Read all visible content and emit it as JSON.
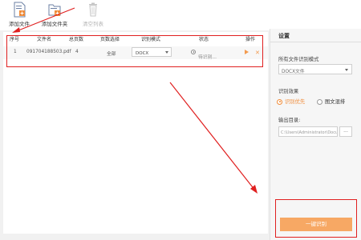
{
  "toolbar": {
    "add_file_label": "添加文件",
    "add_folder_label": "添加文件夹",
    "clear_list_label": "清空列表"
  },
  "file_table": {
    "columns": [
      "序号",
      "文件名",
      "总页数",
      "页数选择",
      "识别模式",
      "状态",
      "操作"
    ],
    "rows": [
      {
        "index": "1",
        "filename": "091704188503.pdf",
        "total_pages": "4",
        "page_selection": "全部",
        "mode": "DOCX",
        "status": "待识别..."
      }
    ]
  },
  "settings": {
    "title": "设置",
    "all_files_mode_label": "所有文件识别模式",
    "all_files_mode_value": "DOCX文件",
    "effect_label": "识别效果",
    "effect_options": [
      "识别优先",
      "图文混排"
    ],
    "effect_selected_index": 0,
    "output_dir_label": "输出目录:",
    "output_dir_value": "C:\\Users\\Administrator\\Docu",
    "browse_label": "...",
    "start_button_label": "一键识别"
  },
  "colors": {
    "accent": "#f08c3a",
    "start_button": "#f7a864",
    "annotation": "#e02020"
  },
  "icons": {
    "add_file": "add-file-icon",
    "add_folder": "add-folder-icon",
    "clear_list": "trash-icon",
    "status": "clock-icon",
    "start": "play-icon",
    "delete": "close-icon"
  }
}
